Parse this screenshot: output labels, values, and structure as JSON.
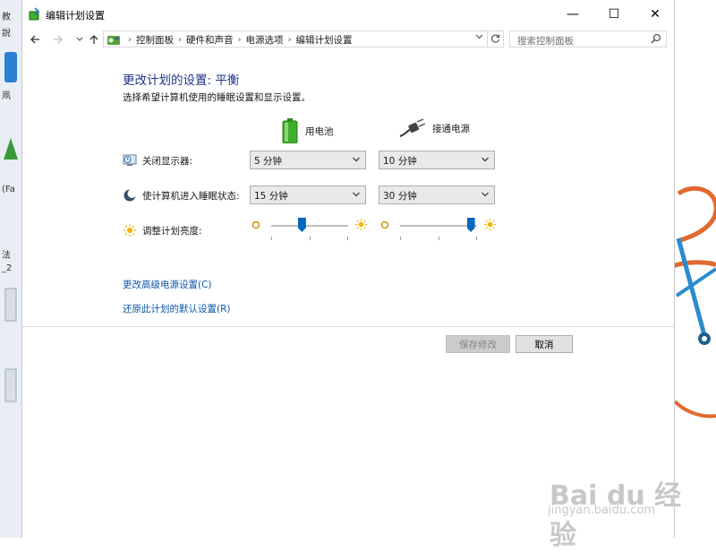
{
  "desktop": {
    "fragments": [
      "教",
      "說",
      "凧",
      "(Fa",
      "法",
      "_2"
    ]
  },
  "watermark": {
    "brand": "Bai du 经验",
    "url": "jingyan.baidu.com"
  },
  "window": {
    "title": "编辑计划设置",
    "controls": {
      "minimize": "—",
      "maximize": "☐",
      "close": "✕"
    }
  },
  "nav": {
    "breadcrumbs": [
      "控制面板",
      "硬件和声音",
      "电源选项",
      "编辑计划设置"
    ],
    "search_placeholder": "搜索控制面板"
  },
  "plan": {
    "heading": "更改计划的设置: 平衡",
    "subtitle": "选择希望计算机使用的睡眠设置和显示设置。",
    "columns": {
      "battery": "用电池",
      "plugged": "接通电源"
    },
    "display_off": {
      "label": "关闭显示器:",
      "battery": "5 分钟",
      "plugged": "10 分钟"
    },
    "sleep": {
      "label": "使计算机进入睡眠状态:",
      "battery": "15 分钟",
      "plugged": "30 分钟"
    },
    "brightness": {
      "label": "调整计划亮度:",
      "battery_level": 0.4,
      "plugged_level": 0.92
    }
  },
  "links": {
    "advanced": "更改高级电源设置(C)",
    "restore": "还原此计划的默认设置(R)"
  },
  "buttons": {
    "save": "保存修改",
    "cancel": "取消"
  },
  "colors": {
    "heading": "#1e3287",
    "link": "#0b56a8",
    "slider_thumb": "#0067c0",
    "battery_green": "#3fae2a"
  }
}
